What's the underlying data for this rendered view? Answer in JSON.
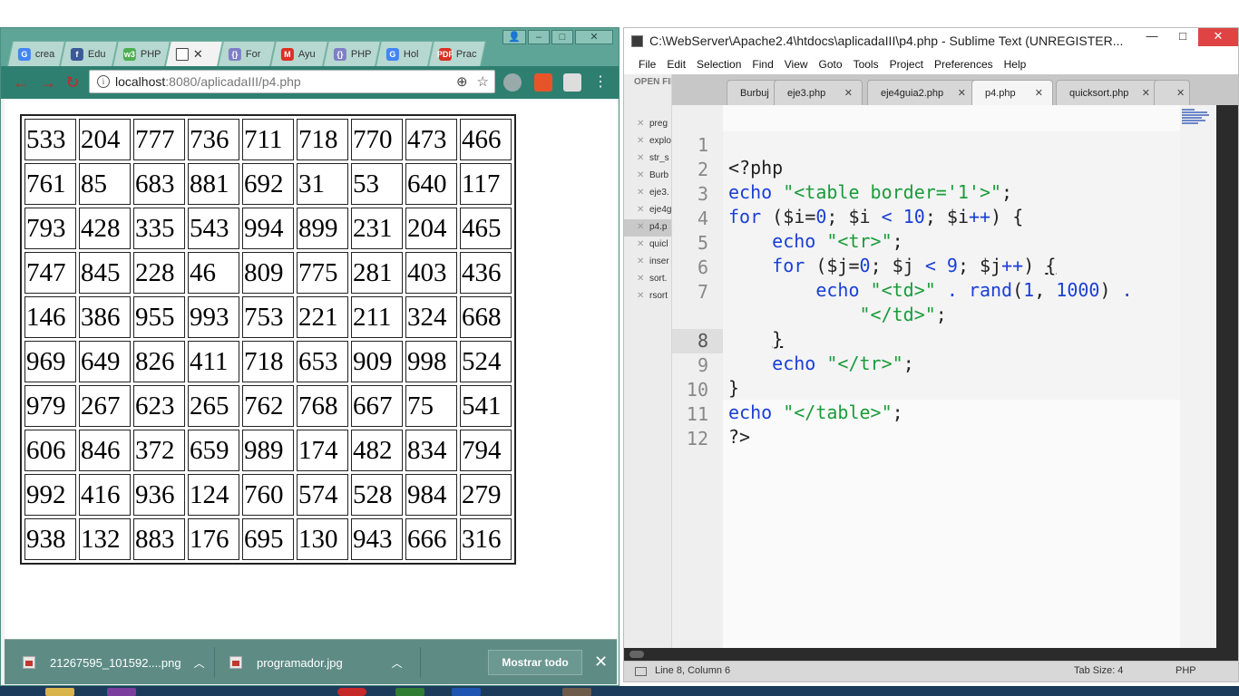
{
  "chrome": {
    "tabs": [
      {
        "title": "crea",
        "icon": "google-icon",
        "icon_letter": "G",
        "color": "#4285f4",
        "active": false
      },
      {
        "title": "Edu",
        "icon": "facebook-icon",
        "icon_letter": "f",
        "color": "#3b5998",
        "active": false
      },
      {
        "title": "PHP",
        "icon": "w3schools-icon",
        "icon_letter": "w3",
        "color": "#4caf50",
        "active": false
      },
      {
        "title": "",
        "icon": "page-icon",
        "icon_letter": "",
        "color": "#ffffff",
        "active": true
      },
      {
        "title": "For",
        "icon": "code-icon",
        "icon_letter": "{}",
        "color": "#7e7ec7",
        "active": false
      },
      {
        "title": "Ayu",
        "icon": "gmail-icon",
        "icon_letter": "M",
        "color": "#d93025",
        "active": false
      },
      {
        "title": "PHP",
        "icon": "code-icon",
        "icon_letter": "{}",
        "color": "#7e7ec7",
        "active": false
      },
      {
        "title": "Hol",
        "icon": "google-icon",
        "icon_letter": "G",
        "color": "#4285f4",
        "active": false
      },
      {
        "title": "Prac",
        "icon": "pdf-icon",
        "icon_letter": "PDF",
        "color": "#d93025",
        "active": false
      }
    ],
    "active_tab_close": "✕",
    "url": {
      "host": "localhost",
      "rest": ":8080/aplicadaIII/p4.php"
    },
    "table": [
      [
        533,
        204,
        777,
        736,
        711,
        718,
        770,
        473,
        466
      ],
      [
        761,
        85,
        683,
        881,
        692,
        31,
        53,
        640,
        117
      ],
      [
        793,
        428,
        335,
        543,
        994,
        899,
        231,
        204,
        465
      ],
      [
        747,
        845,
        228,
        46,
        809,
        775,
        281,
        403,
        436
      ],
      [
        146,
        386,
        955,
        993,
        753,
        221,
        211,
        324,
        668
      ],
      [
        969,
        649,
        826,
        411,
        718,
        653,
        909,
        998,
        524
      ],
      [
        979,
        267,
        623,
        265,
        762,
        768,
        667,
        75,
        541
      ],
      [
        606,
        846,
        372,
        659,
        989,
        174,
        482,
        834,
        794
      ],
      [
        992,
        416,
        936,
        124,
        760,
        574,
        528,
        984,
        279
      ],
      [
        938,
        132,
        883,
        176,
        695,
        130,
        943,
        666,
        316
      ]
    ],
    "downloads": [
      {
        "name": "21267595_101592....png"
      },
      {
        "name": "programador.jpg"
      }
    ],
    "show_all": "Mostrar todo",
    "close_glyph": "✕"
  },
  "sublime": {
    "title": "C:\\WebServer\\Apache2.4\\htdocs\\aplicadaIII\\p4.php - Sublime Text (UNREGISTER...",
    "menu": [
      "File",
      "Edit",
      "Selection",
      "Find",
      "View",
      "Goto",
      "Tools",
      "Project",
      "Preferences",
      "Help"
    ],
    "sidebar_header": "OPEN FILES",
    "open_files": [
      "preg",
      "explo",
      "str_s",
      "Burb",
      "eje3.",
      "eje4g",
      "p4.p",
      "quicl",
      "inser",
      "sort.",
      "rsort"
    ],
    "active_file_index": 6,
    "tabs": [
      {
        "label": "Burbuj",
        "close": ""
      },
      {
        "label": "eje3.php",
        "close": "✕"
      },
      {
        "label": "eje4guia2.php",
        "close": "✕"
      },
      {
        "label": "p4.php",
        "close": "✕",
        "active": true
      },
      {
        "label": "quicksort.php",
        "close": "✕"
      },
      {
        "label": "",
        "close": "✕"
      }
    ],
    "line_numbers": [
      "1",
      "2",
      "3",
      "4",
      "5",
      "6",
      "7",
      "",
      "8",
      "9",
      "10",
      "11",
      "12"
    ],
    "status": {
      "position": "Line 8, Column 6",
      "tab_size": "Tab Size: 4",
      "syntax": "PHP"
    }
  }
}
